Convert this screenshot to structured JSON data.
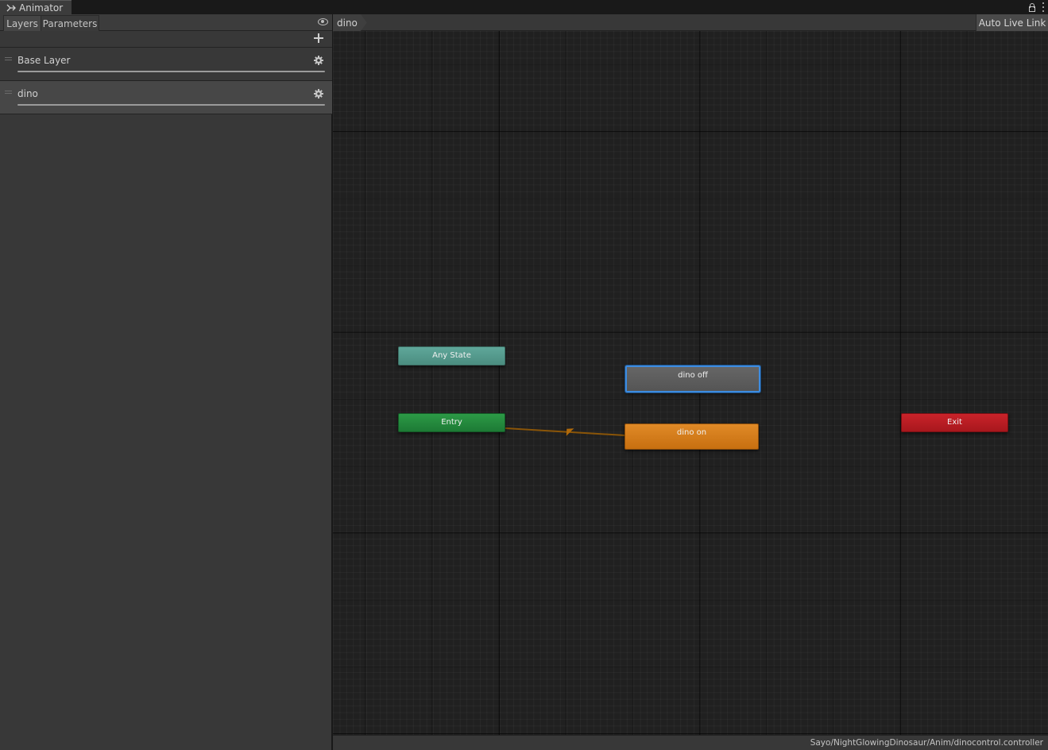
{
  "window": {
    "title": "Animator",
    "title_icon": "animator-icon",
    "icons": [
      "lock-icon",
      "kebab-menu-icon"
    ]
  },
  "left_panel": {
    "tabs": [
      {
        "label": "Layers",
        "selected": true
      },
      {
        "label": "Parameters",
        "selected": false
      }
    ],
    "visibility_icon": "eye-icon",
    "add_icon": "plus-icon",
    "layers": [
      {
        "name": "Base Layer",
        "selected": false,
        "icon": "gear-icon"
      },
      {
        "name": "dino",
        "selected": true,
        "icon": "gear-icon"
      }
    ]
  },
  "graph": {
    "breadcrumb": "dino",
    "live_link_label": "Auto Live Link",
    "states": {
      "any_state": {
        "label": "Any State",
        "color": "#5fa79a"
      },
      "entry": {
        "label": "Entry",
        "color": "#2c9a46"
      },
      "dino_off": {
        "label": "dino off",
        "color": "#5f5f5f",
        "selected": true
      },
      "dino_on": {
        "label": "dino on",
        "color": "#e08a27",
        "default": true
      },
      "exit": {
        "label": "Exit",
        "color": "#c9232a"
      }
    },
    "transitions": [
      {
        "from": "Entry",
        "to": "dino on",
        "color": "#b16a0a"
      }
    ]
  },
  "status": {
    "path": "Sayo/NightGlowingDinosaur/Anim/dinocontrol.controller"
  }
}
